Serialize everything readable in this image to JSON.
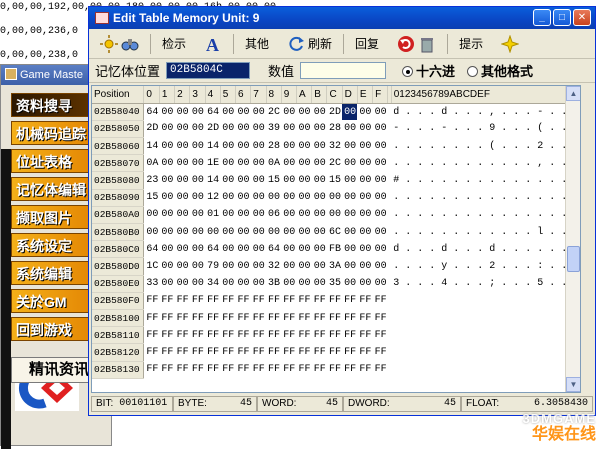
{
  "background": {
    "address_lines": [
      "0,00,00,192,00,00,00,180,00,00,00,16b,00,00,00",
      "0,00,00,236,0",
      "0,00,00,238,0"
    ]
  },
  "game_master": {
    "title": "Game Maste",
    "menu": [
      "资料搜寻",
      "机械码追踪",
      "位址表格",
      "记忆体编辑",
      "撷取图片",
      "系统设定",
      "系统编辑",
      "关於GM",
      "回到游戏"
    ],
    "news_label": "精讯资讯"
  },
  "dialog": {
    "title": "Edit Table  Memory Unit: 9",
    "toolbar": {
      "search": "检示",
      "other": "其他",
      "refresh": "刷新",
      "restore": "回复",
      "tips": "提示"
    },
    "address_label": "记忆体位置",
    "address_value": "02B5804C",
    "value_label": "数值",
    "value_value": "",
    "radio_hex": "十六进",
    "radio_other": "其他格式",
    "radio_selected": "hex"
  },
  "grid": {
    "position_header": "Position",
    "byte_headers": [
      "0",
      "1",
      "2",
      "3",
      "4",
      "5",
      "6",
      "7",
      "8",
      "9",
      "A",
      "B",
      "C",
      "D",
      "E",
      "F"
    ],
    "ascii_header": "0123456789ABCDEF",
    "selected_cell": {
      "row": 0,
      "col": 13
    },
    "rows": [
      {
        "addr": "02B58040",
        "bytes": [
          "64",
          "00",
          "00",
          "00",
          "64",
          "00",
          "00",
          "00",
          "2C",
          "00",
          "00",
          "00",
          "2D",
          "00",
          "00",
          "00"
        ],
        "ascii": "d . . . d . . . , . . . - . . ."
      },
      {
        "addr": "02B58050",
        "bytes": [
          "2D",
          "00",
          "00",
          "00",
          "2D",
          "00",
          "00",
          "00",
          "39",
          "00",
          "00",
          "00",
          "28",
          "00",
          "00",
          "00"
        ],
        "ascii": "- . . . - . . . 9 . . . ( . . ."
      },
      {
        "addr": "02B58060",
        "bytes": [
          "14",
          "00",
          "00",
          "00",
          "14",
          "00",
          "00",
          "00",
          "28",
          "00",
          "00",
          "00",
          "32",
          "00",
          "00",
          "00"
        ],
        "ascii": ". . . . . . . . ( . . . 2 . . ."
      },
      {
        "addr": "02B58070",
        "bytes": [
          "0A",
          "00",
          "00",
          "00",
          "1E",
          "00",
          "00",
          "00",
          "0A",
          "00",
          "00",
          "00",
          "2C",
          "00",
          "00",
          "00"
        ],
        "ascii": ". . . . . . . . . . . . , . . ."
      },
      {
        "addr": "02B58080",
        "bytes": [
          "23",
          "00",
          "00",
          "00",
          "14",
          "00",
          "00",
          "00",
          "15",
          "00",
          "00",
          "00",
          "15",
          "00",
          "00",
          "00"
        ],
        "ascii": "# . . . . . . . . . . . . . . ."
      },
      {
        "addr": "02B58090",
        "bytes": [
          "15",
          "00",
          "00",
          "00",
          "12",
          "00",
          "00",
          "00",
          "00",
          "00",
          "00",
          "00",
          "00",
          "00",
          "00",
          "00"
        ],
        "ascii": ". . . . . . . . . . . . . . . ."
      },
      {
        "addr": "02B580A0",
        "bytes": [
          "00",
          "00",
          "00",
          "00",
          "01",
          "00",
          "00",
          "00",
          "06",
          "00",
          "00",
          "00",
          "00",
          "00",
          "00",
          "00"
        ],
        "ascii": ". . . . . . . . . . . . . . . ."
      },
      {
        "addr": "02B580B0",
        "bytes": [
          "00",
          "00",
          "00",
          "00",
          "00",
          "00",
          "00",
          "00",
          "00",
          "00",
          "00",
          "00",
          "6C",
          "00",
          "00",
          "00"
        ],
        "ascii": ". . . . . . . . . . . . l . . ."
      },
      {
        "addr": "02B580C0",
        "bytes": [
          "64",
          "00",
          "00",
          "00",
          "64",
          "00",
          "00",
          "00",
          "64",
          "00",
          "00",
          "00",
          "FB",
          "00",
          "00",
          "00"
        ],
        "ascii": "d . . . d . . . d . . . . . . ."
      },
      {
        "addr": "02B580D0",
        "bytes": [
          "1C",
          "00",
          "00",
          "00",
          "79",
          "00",
          "00",
          "00",
          "32",
          "00",
          "00",
          "00",
          "3A",
          "00",
          "00",
          "00"
        ],
        "ascii": ". . . . y . . . 2 . . . : . . ."
      },
      {
        "addr": "02B580E0",
        "bytes": [
          "33",
          "00",
          "00",
          "00",
          "34",
          "00",
          "00",
          "00",
          "3B",
          "00",
          "00",
          "00",
          "35",
          "00",
          "00",
          "00"
        ],
        "ascii": "3 . . . 4 . . . ; . . . 5 . . ."
      },
      {
        "addr": "02B580F0",
        "bytes": [
          "FF",
          "FF",
          "FF",
          "FF",
          "FF",
          "FF",
          "FF",
          "FF",
          "FF",
          "FF",
          "FF",
          "FF",
          "FF",
          "FF",
          "FF",
          "FF"
        ],
        "ascii": ""
      },
      {
        "addr": "02B58100",
        "bytes": [
          "FF",
          "FF",
          "FF",
          "FF",
          "FF",
          "FF",
          "FF",
          "FF",
          "FF",
          "FF",
          "FF",
          "FF",
          "FF",
          "FF",
          "FF",
          "FF"
        ],
        "ascii": ""
      },
      {
        "addr": "02B58110",
        "bytes": [
          "FF",
          "FF",
          "FF",
          "FF",
          "FF",
          "FF",
          "FF",
          "FF",
          "FF",
          "FF",
          "FF",
          "FF",
          "FF",
          "FF",
          "FF",
          "FF"
        ],
        "ascii": ""
      },
      {
        "addr": "02B58120",
        "bytes": [
          "FF",
          "FF",
          "FF",
          "FF",
          "FF",
          "FF",
          "FF",
          "FF",
          "FF",
          "FF",
          "FF",
          "FF",
          "FF",
          "FF",
          "FF",
          "FF"
        ],
        "ascii": ""
      },
      {
        "addr": "02B58130",
        "bytes": [
          "FF",
          "FF",
          "FF",
          "FF",
          "FF",
          "FF",
          "FF",
          "FF",
          "FF",
          "FF",
          "FF",
          "FF",
          "FF",
          "FF",
          "FF",
          "FF"
        ],
        "ascii": ""
      }
    ]
  },
  "status": {
    "bit_label": "BIT:",
    "bit_value": "00101101",
    "byte_label": "BYTE:",
    "byte_value": "45",
    "word_label": "WORD:",
    "word_value": "45",
    "dword_label": "DWORD:",
    "dword_value": "45",
    "float_label": "FLOAT:",
    "float_value": "6.3058430"
  },
  "watermark": {
    "line1": "3DMGAME",
    "line2": "华娱在线"
  }
}
